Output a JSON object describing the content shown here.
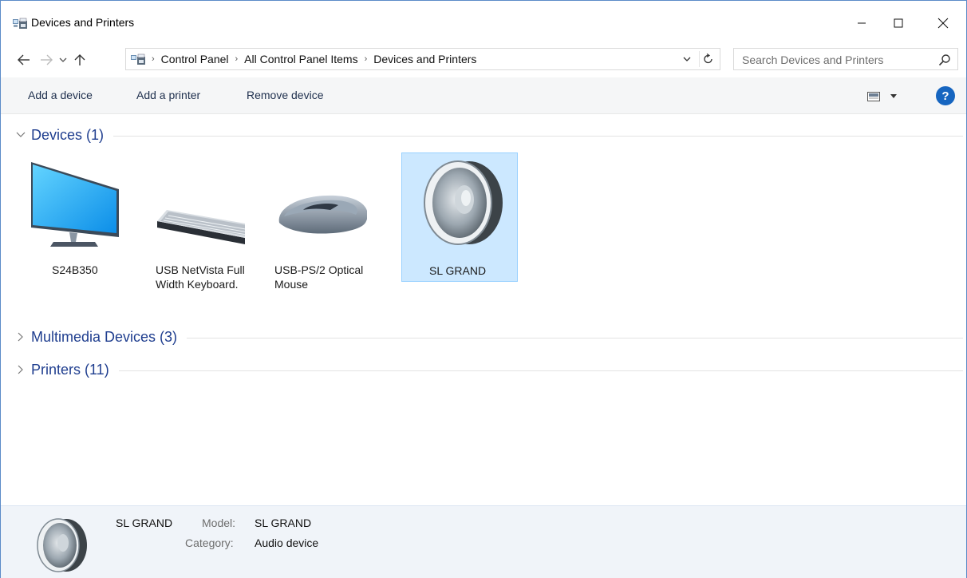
{
  "window": {
    "title": "Devices and Printers",
    "controls": {
      "minimize": "minimize",
      "maximize": "maximize",
      "close": "close"
    }
  },
  "address": {
    "breadcrumbs": [
      "Control Panel",
      "All Control Panel Items",
      "Devices and Printers"
    ],
    "search_placeholder": "Search Devices and Printers"
  },
  "toolbar": {
    "add_device": "Add a device",
    "add_printer": "Add a printer",
    "remove_device": "Remove device"
  },
  "groups": {
    "devices": {
      "title": "Devices (1)",
      "expanded": true
    },
    "multimedia": {
      "title": "Multimedia Devices (3)",
      "expanded": false
    },
    "printers": {
      "title": "Printers (11)",
      "expanded": false
    }
  },
  "devices": [
    {
      "line1": "S24B350",
      "line2": "",
      "icon": "monitor-icon"
    },
    {
      "line1": "USB NetVista Full",
      "line2": "Width Keyboard.",
      "icon": "keyboard-icon"
    },
    {
      "line1": "USB-PS/2 Optical",
      "line2": "Mouse",
      "icon": "mouse-icon"
    },
    {
      "line1": "SL GRAND",
      "line2": "",
      "icon": "speaker-icon",
      "selected": true
    }
  ],
  "details": {
    "name": "SL GRAND",
    "model_label": "Model:",
    "model": "SL GRAND",
    "category_label": "Category:",
    "category": "Audio device"
  },
  "colors": {
    "accent_link": "#1f3e8f",
    "selection_bg": "#cce8ff",
    "details_bg": "#f0f4f9",
    "help": "#1665c0"
  }
}
